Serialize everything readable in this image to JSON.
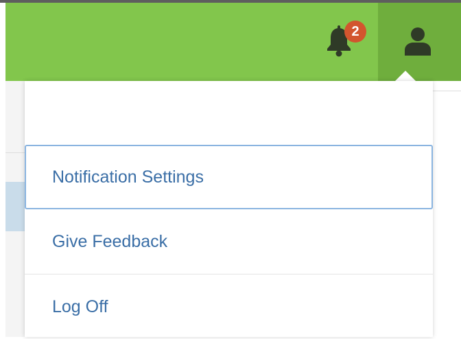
{
  "topbar": {
    "notifications": {
      "icon": "bell-icon",
      "badge_count": "2",
      "badge_color": "#d2552e"
    },
    "user": {
      "icon": "user-icon"
    },
    "bar_color": "#82c64c",
    "active_color": "#6fae3d"
  },
  "menu": {
    "items": [
      {
        "label": "Notification Settings",
        "focused": true
      },
      {
        "label": "Give Feedback"
      },
      {
        "label": "Log Off"
      }
    ],
    "link_color": "#3a6ea6"
  }
}
